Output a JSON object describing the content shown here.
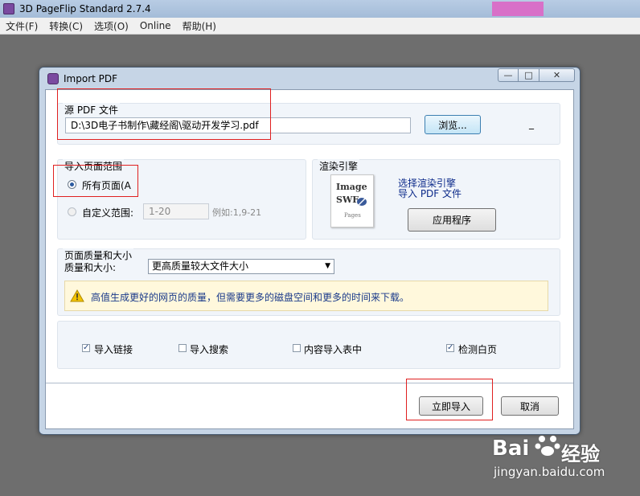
{
  "app": {
    "title": "3D PageFlip Standard 2.7.4",
    "menu": [
      "文件(F)",
      "转换(C)",
      "选项(O)",
      "Online",
      "帮助(H)"
    ]
  },
  "dialog": {
    "title": "Import PDF",
    "controls": {
      "minimize": "—",
      "maximize": "□",
      "close": "✕"
    },
    "source": {
      "group_label": "源 PDF 文件",
      "path": "D:\\3D电子书制作\\藏经阁\\驱动开发学习.pdf",
      "browse_label": "浏览...",
      "dash": "_"
    },
    "page_range": {
      "group_label": "导入页面范围",
      "all_pages_label": "所有页面(A",
      "all_pages_checked": true,
      "custom_label": "自定义范围:",
      "custom_value": "1-20",
      "example": "例如:1,9-21"
    },
    "render_engine": {
      "group_label": "渲染引擎",
      "image_lines": [
        "Image",
        "SWF",
        "Pages"
      ],
      "link1": "选择渲染引擎",
      "link2": "导入 PDF 文件",
      "apply_label": "应用程序"
    },
    "quality": {
      "group_label": "页面质量和大小",
      "field_label": "质量和大小:",
      "selected": "更高质量较大文件大小",
      "warning": "高值生成更好的网页的质量，但需要更多的磁盘空间和更多的时间来下载。"
    },
    "options": [
      {
        "label": "导入链接",
        "checked": true
      },
      {
        "label": "导入搜索",
        "checked": false
      },
      {
        "label": "内容导入表中",
        "checked": false
      },
      {
        "label": "检测白页",
        "checked": true
      }
    ],
    "import_label": "立即导入",
    "cancel_label": "取消"
  },
  "watermark": {
    "brand": "Bai",
    "brand2": "经验",
    "url": "jingyan.baidu.com"
  },
  "colors": {
    "highlight": "#e02020",
    "link": "#0c2a8a",
    "warning_bg": "#fff8dc"
  }
}
